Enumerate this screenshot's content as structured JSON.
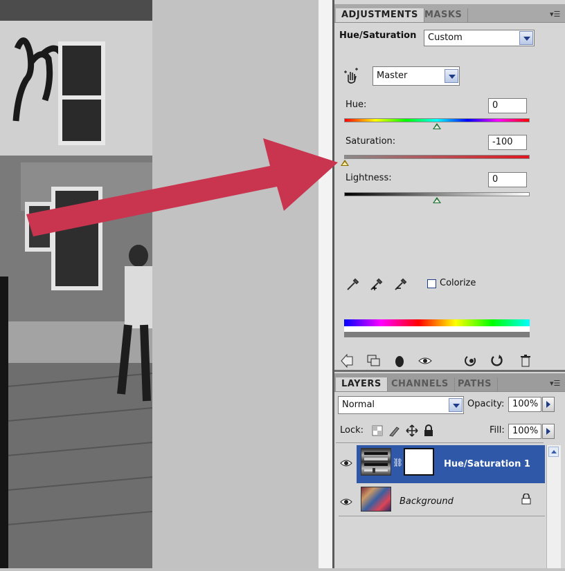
{
  "adjustments_panel": {
    "tabs": [
      {
        "label": "ADJUSTMENTS",
        "active": true
      },
      {
        "label": "MASKS",
        "active": false
      }
    ],
    "title": "Hue/Saturation",
    "preset_value": "Custom",
    "channel_value": "Master",
    "hue_label": "Hue:",
    "hue_value": "0",
    "saturation_label": "Saturation:",
    "saturation_value": "-100",
    "lightness_label": "Lightness:",
    "lightness_value": "0",
    "colorize_label": "Colorize",
    "colorize_checked": false,
    "slider_levels": {
      "hue": 0.5,
      "saturation": 0.0,
      "lightness": 0.5
    }
  },
  "layers_panel": {
    "tabs": [
      {
        "label": "LAYERS",
        "active": true
      },
      {
        "label": "CHANNELS",
        "active": false
      },
      {
        "label": "PATHS",
        "active": false
      }
    ],
    "blend_mode": "Normal",
    "opacity_label": "Opacity:",
    "opacity_value": "100%",
    "lock_label": "Lock:",
    "fill_label": "Fill:",
    "fill_value": "100%",
    "layers": [
      {
        "name": "Hue/Saturation 1",
        "selected": true,
        "type": "adjustment"
      },
      {
        "name": "Background",
        "selected": false,
        "type": "image",
        "locked": true
      }
    ]
  },
  "colors": {
    "accent_selected": "#2f58a8",
    "arrow": "#c9344f",
    "panel_bg": "#d6d6d6"
  }
}
